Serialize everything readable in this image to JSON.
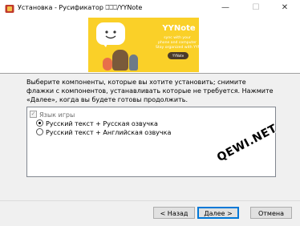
{
  "window": {
    "title": "Установка - Русификатор ⎕⎕⎕/YYNote",
    "minimize_glyph": "—",
    "maximize_glyph": "☐",
    "close_glyph": "✕",
    "icon": "installer-app-icon"
  },
  "banner": {
    "app_name": "YYNote",
    "tagline_1": "sync with your",
    "tagline_2": "phone and computer",
    "tagline_3": "Stay organized with YYNote",
    "download_label": "YYNote",
    "background_color": "#fad028"
  },
  "instructions": "Выберите компоненты, которые вы хотите установить; снимите флажки с компонентов, устанавливать которые не требуется. Нажмите «Далее», когда вы будете готовы продолжить.",
  "components": {
    "group_label": "Язык игры",
    "group_checked": true,
    "options": [
      {
        "label": "Русский текст + Русская озвучка",
        "selected": true
      },
      {
        "label": "Русский текст + Английская озвучка",
        "selected": false
      }
    ]
  },
  "watermark": "QEWI.NET",
  "buttons": {
    "back": "< Назад",
    "next": "Далее >",
    "cancel": "Отмена"
  }
}
